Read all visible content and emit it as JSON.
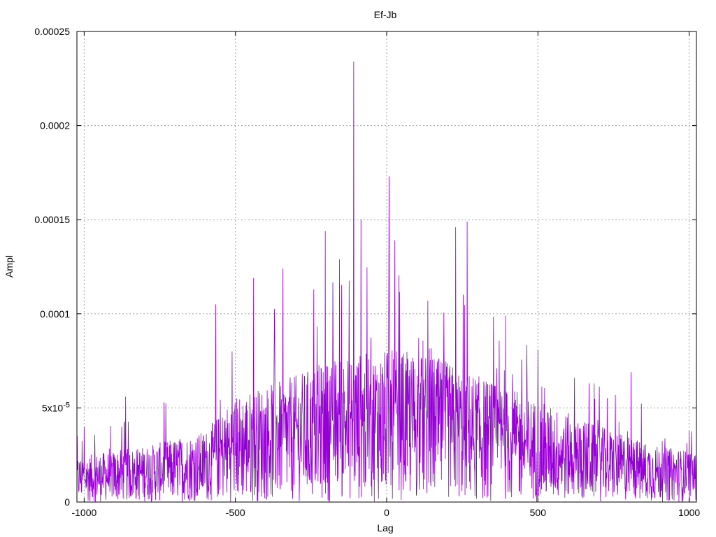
{
  "chart_data": {
    "type": "line",
    "title": "Ef-Jb",
    "xlabel": "Lag",
    "ylabel": "Ampl",
    "xlim": [
      -1024,
      1024
    ],
    "ylim": [
      0,
      0.00025
    ],
    "grid": true,
    "legend": "none",
    "series_color": "#9400d3",
    "x_ticks": [
      {
        "value": -1000,
        "label": "-1000"
      },
      {
        "value": -500,
        "label": "-500"
      },
      {
        "value": 0,
        "label": "0"
      },
      {
        "value": 500,
        "label": "500"
      },
      {
        "value": 1000,
        "label": "1000"
      }
    ],
    "y_ticks": [
      {
        "value": 0,
        "label": "0"
      },
      {
        "value": 5e-05,
        "label": "5x10",
        "exp": "-5"
      },
      {
        "value": 0.0001,
        "label": "0.0001"
      },
      {
        "value": 0.00015,
        "label": "0.00015"
      },
      {
        "value": 0.0002,
        "label": "0.0002"
      },
      {
        "value": 0.00025,
        "label": "0.00025"
      }
    ],
    "peaks": [
      {
        "lag": -1000,
        "ampl": 4e-05
      },
      {
        "lag": -863,
        "ampl": 5.6e-05
      },
      {
        "lag": -736,
        "ampl": 5.3e-05
      },
      {
        "lag": -565,
        "ampl": 0.000105
      },
      {
        "lag": -511,
        "ampl": 8e-05
      },
      {
        "lag": -440,
        "ampl": 0.000119
      },
      {
        "lag": -343,
        "ampl": 0.000124
      },
      {
        "lag": -241,
        "ampl": 0.000113
      },
      {
        "lag": -203,
        "ampl": 0.000144
      },
      {
        "lag": -156,
        "ampl": 0.000129
      },
      {
        "lag": -109,
        "ampl": 0.000234
      },
      {
        "lag": -85,
        "ampl": 0.00015
      },
      {
        "lag": 8,
        "ampl": 0.000173
      },
      {
        "lag": 27,
        "ampl": 0.000139
      },
      {
        "lag": 136,
        "ampl": 0.000107
      },
      {
        "lag": 228,
        "ampl": 0.000146
      },
      {
        "lag": 266,
        "ampl": 0.000149
      },
      {
        "lag": 393,
        "ampl": 9.9e-05
      },
      {
        "lag": 500,
        "ampl": 8.1e-05
      },
      {
        "lag": 669,
        "ampl": 6.3e-05
      },
      {
        "lag": 808,
        "ampl": 6.9e-05
      },
      {
        "lag": 1000,
        "ampl": 3.8e-05
      }
    ],
    "envelope": {
      "x": [
        -1024,
        -800,
        -600,
        -500,
        -300,
        -150,
        0,
        150,
        300,
        500,
        700,
        900,
        1024
      ],
      "y": [
        1.8e-05,
        2.2e-05,
        2.8e-05,
        4.2e-05,
        5e-05,
        5.8e-05,
        6e-05,
        5.8e-05,
        5e-05,
        4e-05,
        3e-05,
        2.2e-05,
        2e-05
      ]
    }
  }
}
